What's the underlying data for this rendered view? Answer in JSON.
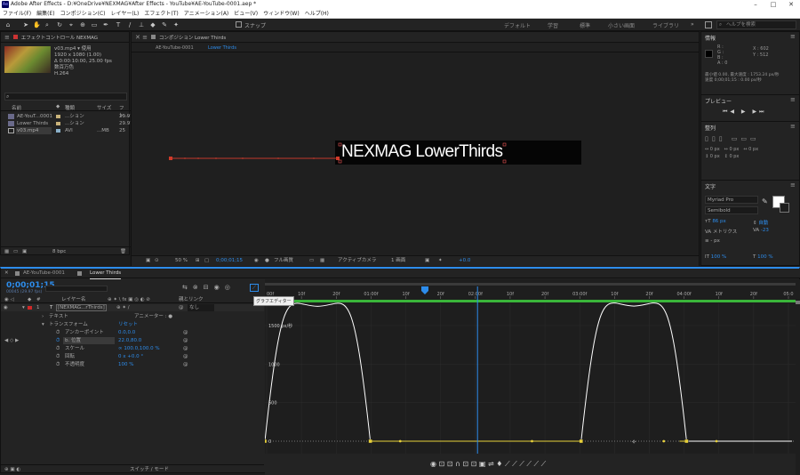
{
  "titlebar": {
    "title": "Adobe After Effects - D:¥OneDrive¥NEXMAG¥After Effects - YouTube¥AE-YouTube-0001.aep *",
    "icon": "Ae"
  },
  "menu": [
    "ファイル(F)",
    "編集(E)",
    "コンポジション(C)",
    "レイヤー(L)",
    "エフェクト(T)",
    "アニメーション(A)",
    "ビュー(V)",
    "ウィンドウ(W)",
    "ヘルプ(H)"
  ],
  "toolbar": {
    "snap_label": "スナップ",
    "workspaces": [
      "デフォルト",
      "学習",
      "標準",
      "小さい画面",
      "ライブラリ"
    ],
    "search_placeholder": "ヘルプを検索"
  },
  "project": {
    "effect_tab": "エフェクトコントロール NEXMAG LowerThirds",
    "file_name": "v03.mp4 ▾",
    "used_label": "使用",
    "details": [
      "1920 x 1080 (1.00)",
      "Δ 0:00:10:00, 25.00 fps",
      "数百万色",
      "H.264"
    ],
    "search_placeholder": "",
    "columns": [
      "名前",
      "種類",
      "サイズ",
      "フレ..."
    ],
    "items": [
      {
        "name": "AE-YouT...0001",
        "type": "...ション",
        "size": "",
        "fps": "29.97"
      },
      {
        "name": "Lower Thirds",
        "type": "...ション",
        "size": "",
        "fps": "29.97"
      },
      {
        "name": "v03.mp4",
        "type": "AVI",
        "size": "...MB",
        "fps": "25"
      }
    ],
    "bpc": "8 bpc"
  },
  "composition": {
    "tab_label": "コンポジション Lower Thirds",
    "crumbs": [
      "AE-YouTube-0001",
      "Lower Thirds"
    ],
    "overlay_text": "NEXMAG LowerThirds",
    "zoom": "50 %",
    "timecode": "0;00;01;15",
    "resolution": "フル画質",
    "camera": "アクティブカメラ",
    "views": "1 画面",
    "exposure": "+0.0"
  },
  "info": {
    "title": "情報",
    "r": "R :",
    "g": "G :",
    "b": "B :",
    "a": "A : 0",
    "x": "X : 602",
    "y": "Y : 512",
    "line1": "最小値 0.00, 最大速度 : 1753.24 px/秒",
    "line2": "速度 0;00;01;15 : 0.00 px/秒"
  },
  "preview": {
    "title": "プレビュー"
  },
  "align": {
    "title": "整列"
  },
  "character": {
    "title": "文字",
    "font": "Myriad Pro",
    "style": "Semibold",
    "size": "86 px",
    "leading_label": "自動",
    "tracking_label": "メトリクス",
    "tracking_value": "-23",
    "stroke": "- px",
    "scale_v": "100 %",
    "scale_h": "100 %"
  },
  "timeline": {
    "tabs": [
      "AE-YouTube-0001",
      "Lower Thirds"
    ],
    "timecode": "0;00;01;15",
    "timecode_sub": "00045 (29.97 fps)",
    "col_layer": "レイヤー名",
    "col_parent": "親とリンク",
    "layer": {
      "num": "1",
      "name": "[NEXMAG...rThirds]",
      "parent": "なし"
    },
    "props": [
      {
        "label": "テキスト",
        "value": "",
        "extra": "アニメーター : ●"
      },
      {
        "label": "トランスフォーム",
        "value": "リセット",
        "extra": ""
      },
      {
        "label": "アンカーポイント",
        "value": "0.0,0.0",
        "extra": ""
      },
      {
        "label": "位置",
        "value": "22.0,80.0",
        "extra": ""
      },
      {
        "label": "スケール",
        "value": "∞ 100.0,100.0 %",
        "extra": ""
      },
      {
        "label": "回転",
        "value": "0 x +0.0 °",
        "extra": ""
      },
      {
        "label": "不透明度",
        "value": "100 %",
        "extra": ""
      }
    ],
    "switch_mode": "スイッチ / モード",
    "tooltip": "グラフエディター",
    "ruler": [
      "00f",
      "10f",
      "20f",
      "01:00f",
      "10f",
      "20f",
      "02:00f",
      "10f",
      "20f",
      "03:00f",
      "10f",
      "20f",
      "04:00f",
      "10f",
      "20f",
      "05:0"
    ],
    "graph_labels": [
      "1500 px/秒",
      "1000",
      "500",
      "0"
    ]
  },
  "chart_data": {
    "type": "line",
    "title": "",
    "xlabel": "",
    "ylabel": "px/秒",
    "x_ticks": [
      "00f",
      "10f",
      "20f",
      "01:00f",
      "10f",
      "20f",
      "02:00f",
      "10f",
      "20f",
      "03:00f",
      "10f",
      "20f",
      "04:00f",
      "10f",
      "20f",
      "05:0"
    ],
    "ylim": [
      0,
      1800
    ],
    "series": [
      {
        "x": [
          0,
          5,
          10,
          15,
          20,
          25,
          30,
          35,
          40,
          50,
          55,
          60,
          65,
          70,
          75,
          80,
          85,
          90,
          100
        ],
        "values": [
          0,
          1200,
          1750,
          1200,
          0,
          0,
          0,
          0,
          0,
          0,
          0,
          0,
          1200,
          1753,
          1200,
          0,
          0,
          0,
          0
        ]
      }
    ]
  },
  "colors": {
    "accent": "#2d8ceb",
    "curve": "#ffffff",
    "keyframe": "#e8d13b",
    "playhead": "#2d8ceb",
    "layer_label": "#d02828"
  }
}
